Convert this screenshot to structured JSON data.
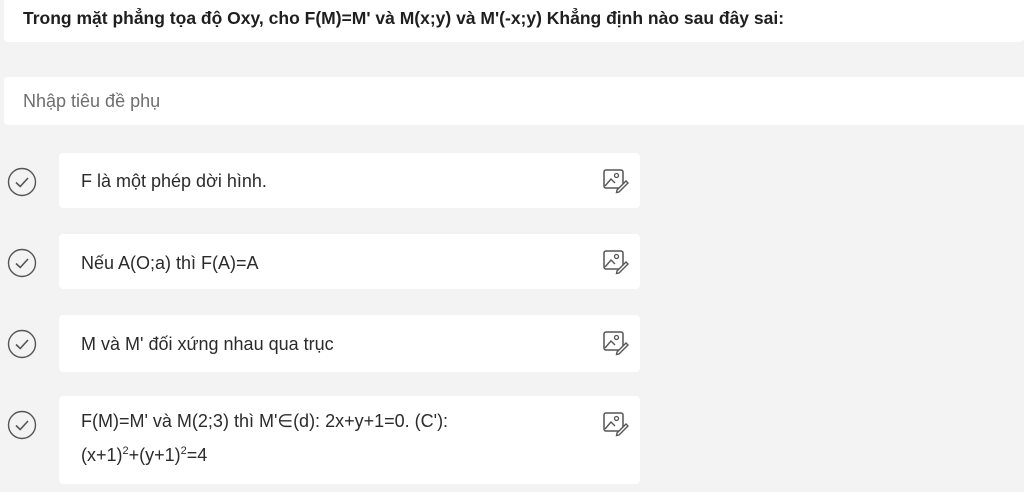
{
  "question": {
    "title": "Trong mặt phẳng tọa độ Oxy, cho F(M)=M' và M(x;y) và M'(-x;y) Khẳng định nào sau đây sai:"
  },
  "subtitle": {
    "placeholder": "Nhập tiêu đề phụ"
  },
  "options": [
    {
      "text": "F là một phép dời hình."
    },
    {
      "text": "Nếu A(O;a) thì F(A)=A"
    },
    {
      "text": "M và M' đối xứng nhau qua trục"
    },
    {
      "line1": "F(M)=M' và M(2;3) thì M'∈(d): 2x+y+1=0. (C'):",
      "l2_a": "(x+1)",
      "l2_exp1": "2",
      "l2_b": "+(y+1)",
      "l2_exp2": "2",
      "l2_c": "=4"
    }
  ],
  "icons": {
    "check": "check-circle-icon",
    "image": "insert-image-icon"
  },
  "colors": {
    "background": "#f3f3f3",
    "card": "#ffffff",
    "icon": "#555555"
  }
}
